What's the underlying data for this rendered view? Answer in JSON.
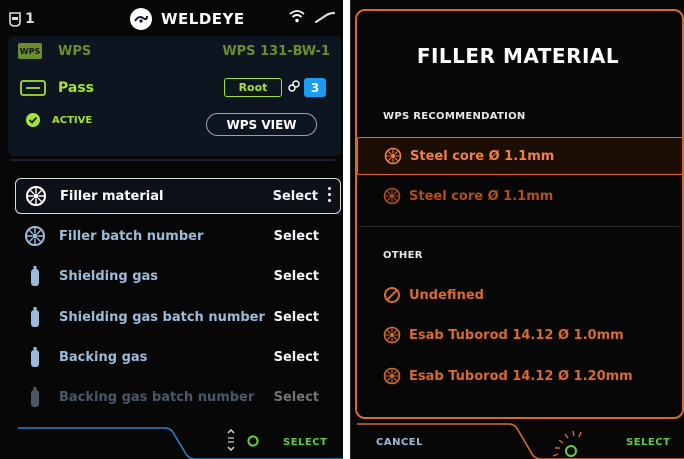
{
  "left": {
    "status": {
      "user_id": "1",
      "app_name": "WELDEYE"
    },
    "wps": {
      "badge": "WPS",
      "label": "WPS",
      "value": "WPS 131-BW-1"
    },
    "pass": {
      "label": "Pass",
      "root": "Root",
      "count": "3"
    },
    "state": {
      "label": "ACTIVE"
    },
    "wps_view_button": "WPS VIEW",
    "items": [
      {
        "label": "Filler material",
        "action": "Select",
        "icon": "spool-icon"
      },
      {
        "label": "Filler batch number",
        "action": "Select",
        "icon": "spool-icon"
      },
      {
        "label": "Shielding gas",
        "action": "Select",
        "icon": "gas-bottle-icon"
      },
      {
        "label": "Shielding gas batch number",
        "action": "Select",
        "icon": "gas-bottle-icon"
      },
      {
        "label": "Backing gas",
        "action": "Select",
        "icon": "gas-bottle-icon"
      },
      {
        "label": "Backing gas batch number",
        "action": "Select",
        "icon": "gas-bottle-icon"
      }
    ],
    "footer": {
      "select": "SELECT"
    }
  },
  "right": {
    "title": "FILLER MATERIAL",
    "section_recommendation": "WPS RECOMMENDATION",
    "section_other": "OTHER",
    "recommendations": [
      {
        "label": "Steel core Ø 1.1mm"
      },
      {
        "label": "Steel core Ø 1.1mm"
      }
    ],
    "others": [
      {
        "label": "Undefined"
      },
      {
        "label": "Esab Tuborod 14.12 Ø 1.0mm"
      },
      {
        "label": "Esab Tuborod 14.12 Ø 1.20mm"
      }
    ],
    "footer": {
      "cancel": "CANCEL",
      "select": "SELECT"
    }
  },
  "colors": {
    "accent_green": "#a6e22e",
    "accent_orange": "#d96a2c",
    "accent_blue": "#1a9cf0",
    "select_green": "#5ccf3a"
  }
}
